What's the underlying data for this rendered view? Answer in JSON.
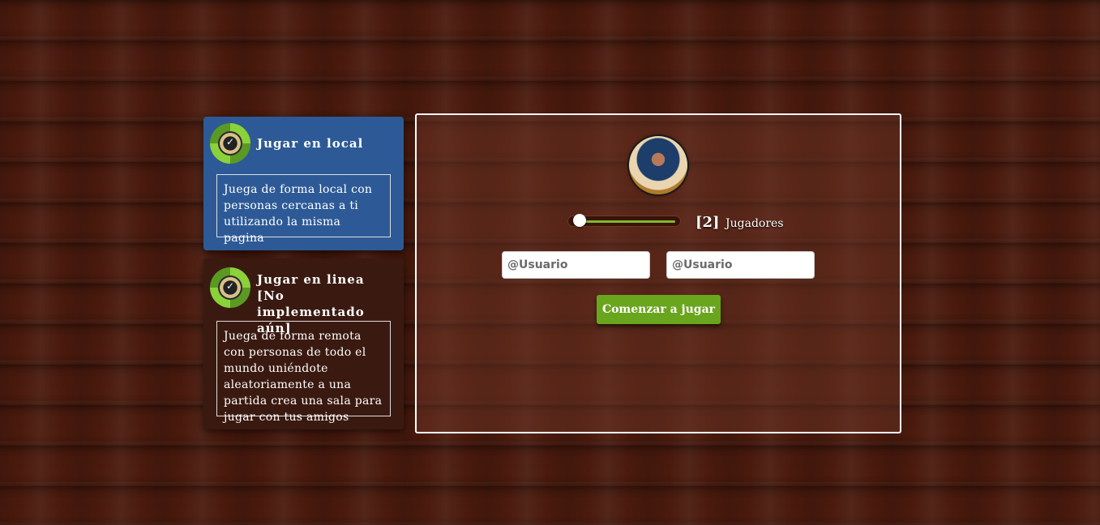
{
  "modes": [
    {
      "title": "Jugar en local",
      "description": "Juega de forma local con personas cercanas a ti utilizando la misma pagina",
      "icon": "compass-badge-icon",
      "active": true
    },
    {
      "title": "Jugar en linea [No implementado aún]",
      "description": "Juega de forma remota con personas de todo el mundo uniéndote aleatoriamente a una partida crea una sala para jugar con tus amigos",
      "icon": "compass-badge-icon",
      "active": false
    }
  ],
  "setup": {
    "avatar_icon": "player-avatar-icon",
    "players": {
      "count": "[2]",
      "label": "Jugadores",
      "slider_fraction": 0
    },
    "inputs": [
      {
        "placeholder": "@Usuario",
        "value": ""
      },
      {
        "placeholder": "@Usuario",
        "value": ""
      }
    ],
    "start_label": "Comenzar a jugar"
  },
  "colors": {
    "active_card": "#2d5a96",
    "inactive_card": "#3a1a10",
    "accent_green": "#6aa51e",
    "background": "#4a1a0d"
  }
}
